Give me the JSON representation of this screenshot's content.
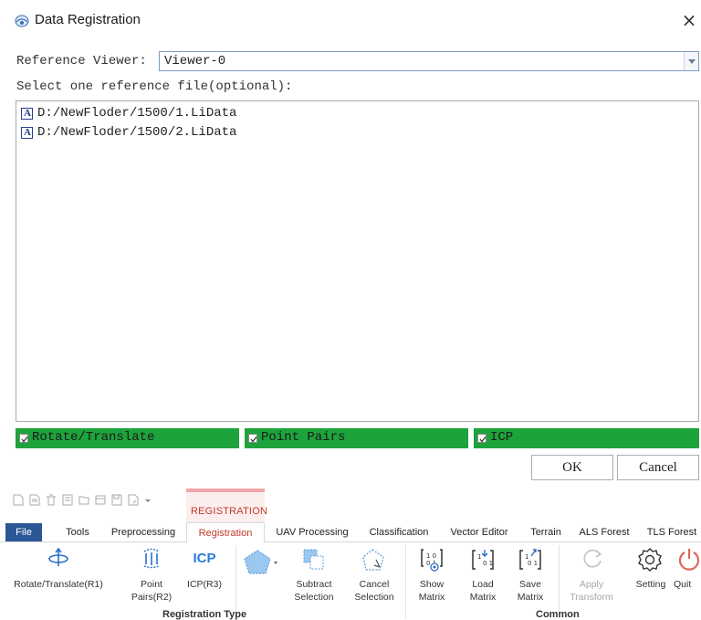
{
  "dialog": {
    "title": "Data Registration",
    "close_icon": "close-icon",
    "reference_viewer_label": "Reference Viewer:",
    "reference_viewer_value": "Viewer-0",
    "select_label": "Select one reference file(optional):",
    "files": [
      "D:/NewFloder/1500/1.LiData",
      "D:/NewFloder/1500/2.LiData"
    ],
    "options": [
      {
        "label": "Rotate/Translate",
        "checked": true
      },
      {
        "label": "Point Pairs",
        "checked": true
      },
      {
        "label": "ICP",
        "checked": true
      }
    ],
    "ok_label": "OK",
    "cancel_label": "Cancel",
    "colors": {
      "option_bar": "#1da33b",
      "combo_border": "#7a9cc6"
    }
  },
  "ribbon": {
    "context_tab_label": "REGISTRATION",
    "tabs": [
      "File",
      "Tools",
      "Preprocessing",
      "Registration",
      "UAV Processing",
      "Classification",
      "Vector Editor",
      "Terrain",
      "ALS Forest",
      "TLS Forest"
    ],
    "active_tab": "Registration",
    "tools": [
      {
        "label": "Rotate/Translate(R1)",
        "icon": "rotate-translate-icon"
      },
      {
        "label": "Point Pairs(R2)",
        "label_lines": [
          "Point",
          "Pairs(R2)"
        ],
        "icon": "point-pairs-icon"
      },
      {
        "label": "ICP(R3)",
        "icon": "icp-icon",
        "icon_text": "ICP"
      },
      {
        "label": "",
        "icon": "pentagon-selection-icon"
      },
      {
        "label_lines": [
          "Subtract",
          "Selection"
        ],
        "icon": "subtract-selection-icon"
      },
      {
        "label_lines": [
          "Cancel",
          "Selection"
        ],
        "icon": "cancel-selection-icon"
      },
      {
        "label_lines": [
          "Show",
          "Matrix"
        ],
        "icon": "show-matrix-icon"
      },
      {
        "label_lines": [
          "Load",
          "Matrix"
        ],
        "icon": "load-matrix-icon"
      },
      {
        "label_lines": [
          "Save",
          "Matrix"
        ],
        "icon": "save-matrix-icon"
      },
      {
        "label_lines": [
          "Apply",
          "Transform"
        ],
        "icon": "apply-transform-icon",
        "disabled": true
      },
      {
        "label": "Setting",
        "icon": "gear-icon"
      },
      {
        "label": "Quit",
        "icon": "power-icon"
      }
    ],
    "groups": [
      "Registration Type",
      "Common"
    ],
    "colors": {
      "file_tab": "#2b5797",
      "context_accent": "#c0392b",
      "icp_blue": "#2a7bd6"
    }
  }
}
